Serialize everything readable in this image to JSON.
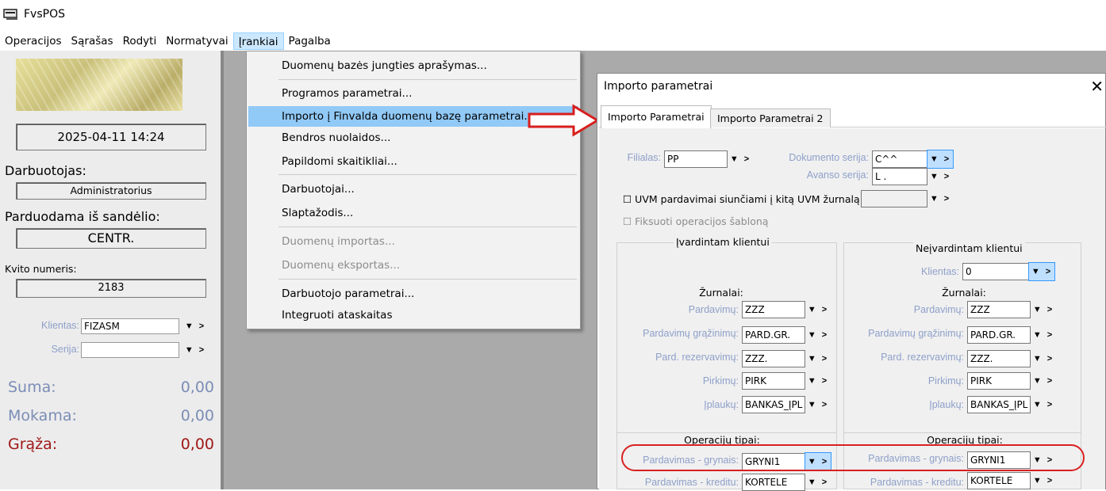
{
  "window": {
    "title": "FvsPOS"
  },
  "menubar": [
    "Operacijos",
    "Sąrašas",
    "Rodyti",
    "Normatyvai",
    "Įrankiai",
    "Pagalba"
  ],
  "left": {
    "datetime": "2025-04-11 14:24",
    "employee_label": "Darbuotojas:",
    "employee": "Administratorius",
    "warehouse_label": "Parduodama iš sandėlio:",
    "warehouse": "CENTR.",
    "receipt_label": "Kvito numeris:",
    "receipt": "2183",
    "client_label": "Klientas:",
    "client": "FIZASM",
    "series_label": "Serija:",
    "sum_label": "Suma:",
    "sum": "0,00",
    "paying_label": "Mokama:",
    "paying": "0,00",
    "change_label": "Grąža:",
    "change": "0,00"
  },
  "tools_menu": {
    "items": [
      "Duomenų bazės jungties aprašymas...",
      "Programos parametrai...",
      "Importo į Finvalda duomenų bazę parametrai...",
      "Bendros nuolaidos...",
      "Papildomi skaitikliai...",
      "Darbuotojai...",
      "Slaptažodis...",
      "Duomenų importas...",
      "Duomenų eksportas...",
      "Darbuotojo parametrai...",
      "Integruoti ataskaitas"
    ]
  },
  "dialog": {
    "title": "Importo parametrai",
    "close": "✕",
    "tabs": [
      "Importo Parametrai",
      "Importo Parametrai 2"
    ],
    "branch_label": "Filialas:",
    "branch": "PP",
    "doc_series_label": "Dokumento serija:",
    "doc_series": "C^^",
    "advance_series_label": "Avanso serija:",
    "advance_series": "L .",
    "uvm_label": "☐ UVM pardavimai siunčiami į kitą UVM žurnalą:",
    "fix_label": "☐ Fiksuoti operacijos šabloną",
    "named_title": "Įvardintam klientui",
    "unnamed_title": "Neįvardintam klientui",
    "client_label": "Klientas:",
    "client": "0",
    "journals_title": "Žurnalai:",
    "journal_labels": [
      "Pardavimų:",
      "Pardavimų grąžinimų:",
      "Pard. rezervavimų:",
      "Pirkimų:",
      "Įplaukų:"
    ],
    "journals_named": [
      "ZZZ",
      "PARD.GR.",
      "ZZZ.",
      "PIRK",
      "BANKAS_ĮPL"
    ],
    "journals_unnamed": [
      "ZZZ",
      "PARD.GR.",
      "ZZZ.",
      "PIRK",
      "BANKAS_ĮPL"
    ],
    "ops_title": "Operacijų tipai:",
    "op_labels": [
      "Pardavimas - grynais:",
      "Pardavimas - kreditu:"
    ],
    "ops_named": [
      "GRYNI1",
      "KORTELE"
    ],
    "ops_unnamed": [
      "GRYNI1",
      "KORTELE"
    ],
    "dd_glyph": "▼ >"
  }
}
